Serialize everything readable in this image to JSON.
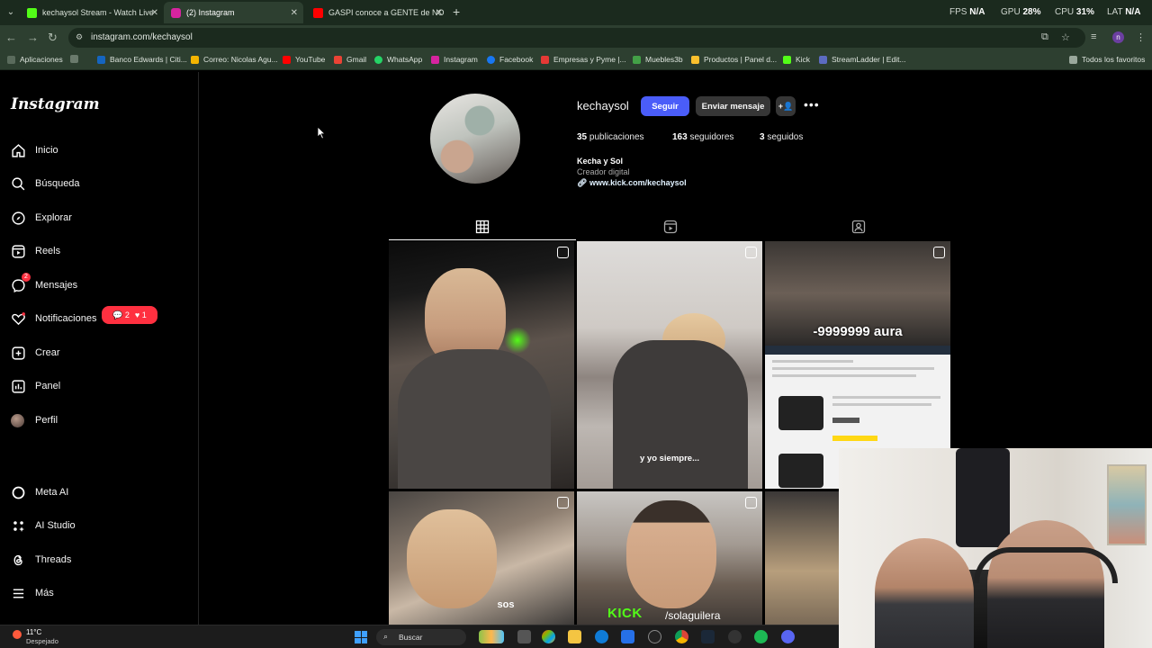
{
  "browser": {
    "tabs": [
      {
        "title": "kechaysol Stream - Watch Live",
        "favicon_color": "#53fc18"
      },
      {
        "title": "(2) Instagram",
        "favicon_color": "#d6249f"
      },
      {
        "title": "GASPI conoce a GENTE de NO",
        "favicon_color": "#ff0000"
      }
    ],
    "perf": {
      "fps_label": "FPS",
      "fps_value": "N/A",
      "gpu_label": "GPU",
      "gpu_value": "28%",
      "cpu_label": "CPU",
      "cpu_value": "31%",
      "lat_label": "LAT",
      "lat_value": "N/A"
    },
    "url": "instagram.com/kechaysol",
    "profile_initial": "n",
    "bookmarks": [
      {
        "label": "Aplicaciones",
        "color": "#4285f4"
      },
      {
        "label": "Banco Edwards | Citi...",
        "color": "#1565c0"
      },
      {
        "label": "Correo: Nicolas Agu...",
        "color": "#f4b400"
      },
      {
        "label": "YouTube",
        "color": "#ff0000"
      },
      {
        "label": "Gmail",
        "color": "#ea4335"
      },
      {
        "label": "WhatsApp",
        "color": "#25d366"
      },
      {
        "label": "Instagram",
        "color": "#d6249f"
      },
      {
        "label": "Facebook",
        "color": "#1877f2"
      },
      {
        "label": "Empresas y Pyme |...",
        "color": "#e53935"
      },
      {
        "label": "Muebles3b",
        "color": "#43a047"
      },
      {
        "label": "Productos | Panel d...",
        "color": "#fbc02d"
      },
      {
        "label": "Kick",
        "color": "#53fc18"
      },
      {
        "label": "StreamLadder | Edit...",
        "color": "#5c6bc0"
      }
    ],
    "all_favorites": "Todos los favoritos"
  },
  "sidebar": {
    "logo": "Instagram",
    "items": [
      {
        "label": "Inicio",
        "icon": "home-icon"
      },
      {
        "label": "Búsqueda",
        "icon": "search-icon"
      },
      {
        "label": "Explorar",
        "icon": "compass-icon"
      },
      {
        "label": "Reels",
        "icon": "reels-icon"
      },
      {
        "label": "Mensajes",
        "icon": "messenger-icon",
        "badge": "2"
      },
      {
        "label": "Notificaciones",
        "icon": "heart-icon"
      },
      {
        "label": "Crear",
        "icon": "plus-square-icon"
      },
      {
        "label": "Panel",
        "icon": "chart-icon"
      },
      {
        "label": "Perfil",
        "icon": "profile-avatar"
      },
      {
        "label": "Meta AI",
        "icon": "meta-ai-icon"
      },
      {
        "label": "AI Studio",
        "icon": "ai-studio-icon"
      },
      {
        "label": "Threads",
        "icon": "threads-icon"
      },
      {
        "label": "Más",
        "icon": "menu-icon"
      }
    ],
    "notif_pill": {
      "comments": "2",
      "likes": "1"
    }
  },
  "profile": {
    "username": "kechaysol",
    "follow_label": "Seguir",
    "message_label": "Enviar mensaje",
    "posts_count": "35",
    "posts_label": "publicaciones",
    "followers_count": "163",
    "followers_label": "seguidores",
    "following_count": "3",
    "following_label": "seguidos",
    "display_name": "Kecha y Sol",
    "category": "Creador digital",
    "link": "www.kick.com/kechaysol"
  },
  "posts": {
    "p2_caption": "y yo siempre...",
    "p3_caption": "-9999999 aura",
    "p4_caption": "sos",
    "p5_caption": "/solaguilera",
    "kick_text": "KICK"
  },
  "taskbar": {
    "temp": "11°C",
    "weather": "Despejado",
    "search_placeholder": "Buscar"
  }
}
